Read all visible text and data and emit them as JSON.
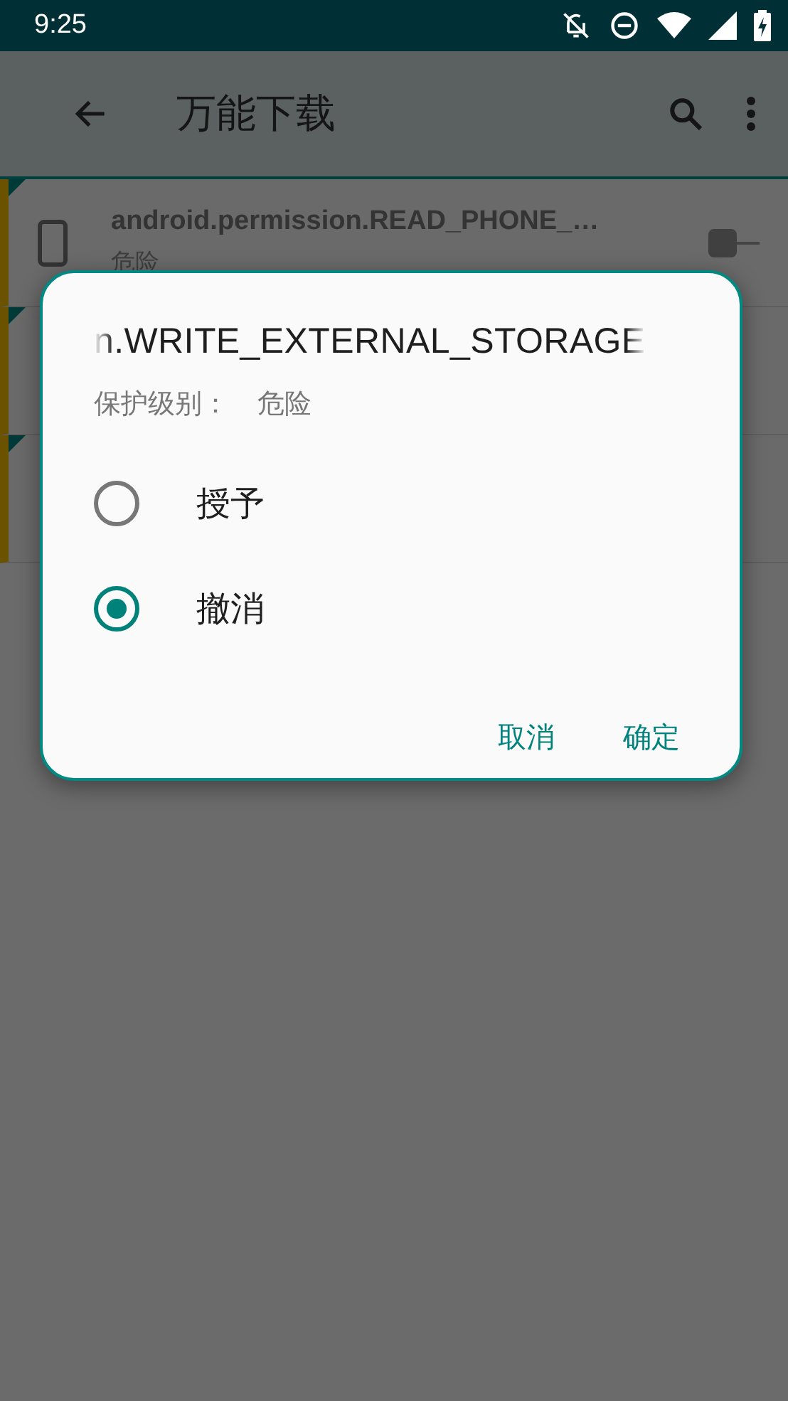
{
  "status_bar": {
    "time": "9:25"
  },
  "app_bar": {
    "title": "万能下载"
  },
  "permissions": [
    {
      "name": "android.permission.READ_PHONE_…",
      "level": "危险",
      "on": false
    }
  ],
  "dialog": {
    "title": "n.WRITE_EXTERNAL_STORAGE",
    "level_label": "保护级别：",
    "level_value": "危险",
    "options": [
      {
        "label": "授予",
        "selected": false
      },
      {
        "label": "撤消",
        "selected": true
      }
    ],
    "buttons": [
      "取消",
      "确定"
    ]
  }
}
